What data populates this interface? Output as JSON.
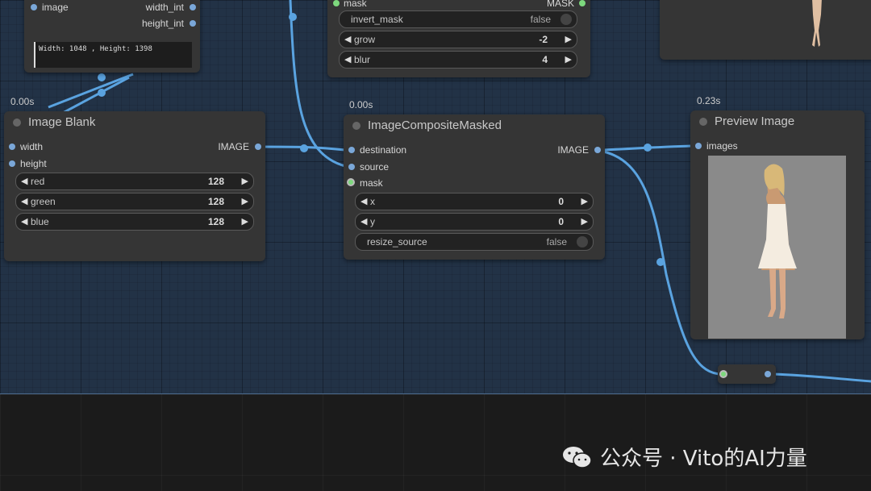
{
  "nodes": {
    "top_left": {
      "inputs": [
        "image"
      ],
      "outputs": [
        "width_int",
        "height_int"
      ],
      "text_output": "Width: 1048 , Height: 1398"
    },
    "mask_node": {
      "input": "mask",
      "output": "MASK",
      "widgets": [
        {
          "label": "invert_mask",
          "value": "false"
        },
        {
          "label": "grow",
          "value": "-2"
        },
        {
          "label": "blur",
          "value": "4"
        }
      ]
    },
    "image_blank": {
      "time": "0.00s",
      "title": "Image Blank",
      "inputs": [
        "width",
        "height"
      ],
      "output": "IMAGE",
      "widgets": [
        {
          "label": "red",
          "value": "128"
        },
        {
          "label": "green",
          "value": "128"
        },
        {
          "label": "blue",
          "value": "128"
        }
      ]
    },
    "composite": {
      "time": "0.00s",
      "title": "ImageCompositeMasked",
      "inputs": [
        "destination",
        "source",
        "mask"
      ],
      "output": "IMAGE",
      "widgets": [
        {
          "label": "x",
          "value": "0"
        },
        {
          "label": "y",
          "value": "0"
        },
        {
          "label": "resize_source",
          "value": "false"
        }
      ]
    },
    "preview": {
      "time": "0.23s",
      "title": "Preview Image",
      "input": "images"
    }
  },
  "watermark": {
    "text": "公众号 · Vito的AI力量",
    "icon": "wechat-icon"
  },
  "colors": {
    "canvas": "#223246",
    "node": "#353535",
    "wire": "#5aa3e0"
  }
}
